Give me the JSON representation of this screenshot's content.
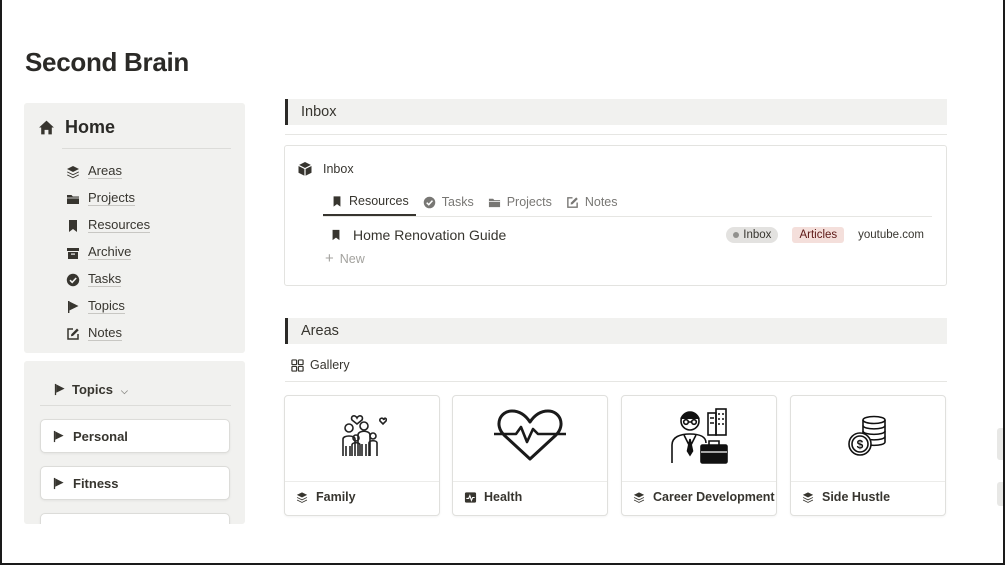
{
  "page": {
    "title": "Second Brain"
  },
  "nav": {
    "home_label": "Home",
    "items": [
      {
        "label": "Areas",
        "icon": "stack-icon"
      },
      {
        "label": "Projects",
        "icon": "folder-icon"
      },
      {
        "label": "Resources",
        "icon": "bookmark-icon"
      },
      {
        "label": "Archive",
        "icon": "archive-box-icon"
      },
      {
        "label": "Tasks",
        "icon": "check-circle-icon"
      },
      {
        "label": "Topics",
        "icon": "flag-icon"
      },
      {
        "label": "Notes",
        "icon": "edit-icon"
      }
    ]
  },
  "topics": {
    "header": "Topics",
    "cards": [
      {
        "label": "Personal"
      },
      {
        "label": "Fitness"
      }
    ]
  },
  "inbox_section": {
    "header": "Inbox",
    "widget_title": "Inbox",
    "tabs": [
      {
        "label": "Resources",
        "active": true
      },
      {
        "label": "Tasks",
        "active": false
      },
      {
        "label": "Projects",
        "active": false
      },
      {
        "label": "Notes",
        "active": false
      }
    ],
    "rows": [
      {
        "title": "Home Renovation Guide",
        "status": "Inbox",
        "type": "Articles",
        "url": "youtube.com"
      }
    ],
    "new_label": "New"
  },
  "areas_section": {
    "header": "Areas",
    "view_label": "Gallery",
    "cards": [
      {
        "label": "Family",
        "icon": "family-icon",
        "caption_icon": "stack-icon"
      },
      {
        "label": "Health",
        "icon": "heart-pulse-icon",
        "caption_icon": "activity-icon"
      },
      {
        "label": "Career Development",
        "icon": "businessman-icon",
        "caption_icon": "stack-icon"
      },
      {
        "label": "Side Hustle",
        "icon": "coins-icon",
        "caption_icon": "stack-icon"
      }
    ]
  },
  "colors": {
    "panel_bg": "#f1f1ef",
    "text": "#37352f",
    "articles_tag_bg": "#f4dfdb",
    "inbox_tag_bg": "#e3e2e0"
  }
}
